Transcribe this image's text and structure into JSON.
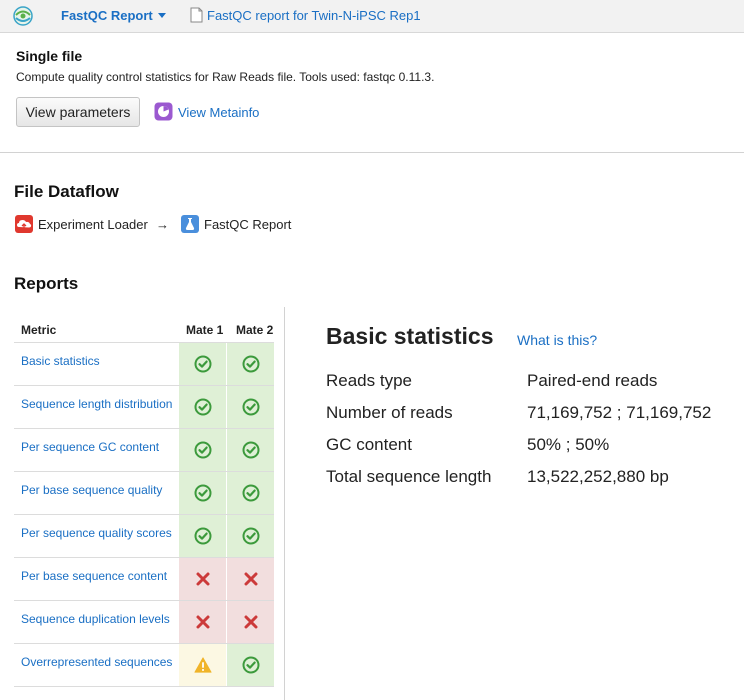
{
  "header": {
    "app_menu_label": "FastQC Report",
    "breadcrumb": "FastQC report for Twin-N-iPSC Rep1"
  },
  "single_file": {
    "title": "Single file",
    "description": "Compute quality control statistics for Raw Reads file. Tools used: fastqc 0.11.3.",
    "view_parameters_label": "View parameters",
    "view_metainfo_label": "View Metainfo"
  },
  "dataflow": {
    "title": "File Dataflow",
    "source": "Experiment Loader",
    "arrow": "→",
    "target": "FastQC Report"
  },
  "reports": {
    "title": "Reports",
    "columns": [
      "Metric",
      "Mate 1",
      "Mate 2"
    ],
    "rows": [
      {
        "label": "Basic statistics",
        "mate1": "pass",
        "mate2": "pass"
      },
      {
        "label": "Sequence length distribution",
        "mate1": "pass",
        "mate2": "pass"
      },
      {
        "label": "Per sequence GC content",
        "mate1": "pass",
        "mate2": "pass"
      },
      {
        "label": "Per base sequence quality",
        "mate1": "pass",
        "mate2": "pass"
      },
      {
        "label": "Per sequence quality scores",
        "mate1": "pass",
        "mate2": "pass"
      },
      {
        "label": "Per base sequence content",
        "mate1": "fail",
        "mate2": "fail"
      },
      {
        "label": "Sequence duplication levels",
        "mate1": "fail",
        "mate2": "fail"
      },
      {
        "label": "Overrepresented sequences",
        "mate1": "warn",
        "mate2": "pass"
      }
    ]
  },
  "basic_statistics": {
    "title": "Basic statistics",
    "help_link": "What is this?",
    "stats": [
      {
        "label": "Reads type",
        "value": "Paired-end reads"
      },
      {
        "label": "Number of reads",
        "value": "71,169,752 ; 71,169,752"
      },
      {
        "label": "GC content",
        "value": "50% ; 50%"
      },
      {
        "label": "Total sequence length",
        "value": "13,522,252,880 bp"
      }
    ]
  },
  "colors": {
    "link": "#1a6fc4",
    "pass_bg": "#dff0d6",
    "fail_bg": "#f2dede",
    "warn_bg": "#fcf8e3",
    "pass_icon": "#3c9a3c",
    "fail_icon": "#cc3a3a",
    "warn_icon": "#f0b429"
  }
}
